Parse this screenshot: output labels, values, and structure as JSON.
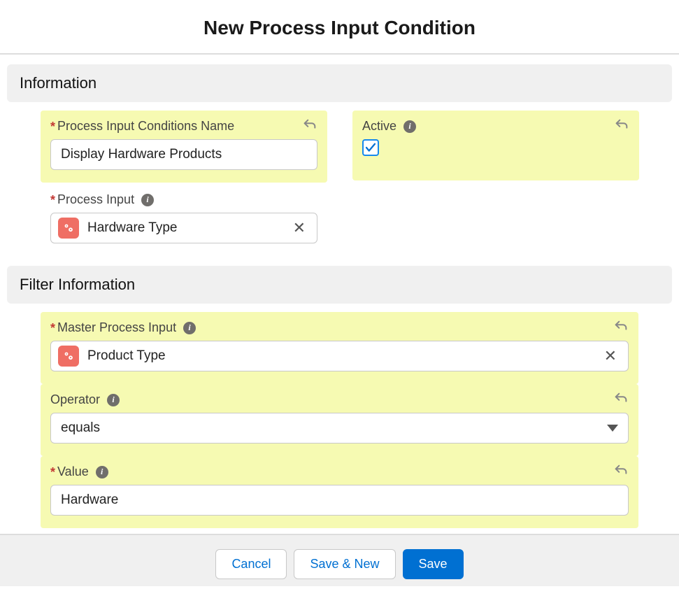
{
  "pageTitle": "New Process Input Condition",
  "sections": {
    "info": {
      "title": "Information"
    },
    "filter": {
      "title": "Filter Information"
    }
  },
  "fields": {
    "name": {
      "label": "Process Input Conditions Name",
      "value": "Display Hardware Products"
    },
    "active": {
      "label": "Active",
      "checked": true
    },
    "processInput": {
      "label": "Process Input",
      "value": "Hardware Type"
    },
    "masterProcessInput": {
      "label": "Master Process Input",
      "value": "Product Type"
    },
    "operator": {
      "label": "Operator",
      "value": "equals"
    },
    "filterValue": {
      "label": "Value",
      "value": "Hardware"
    }
  },
  "buttons": {
    "cancel": "Cancel",
    "saveNew": "Save & New",
    "save": "Save"
  }
}
